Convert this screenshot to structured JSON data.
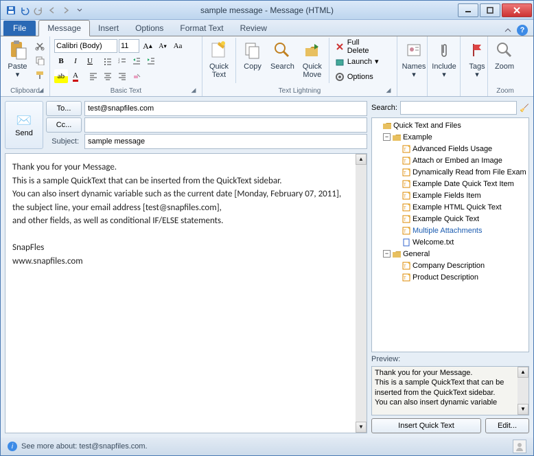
{
  "window": {
    "title": "sample message  -  Message (HTML)"
  },
  "tabs": {
    "file": "File",
    "items": [
      "Message",
      "Insert",
      "Options",
      "Format Text",
      "Review"
    ],
    "active": 0
  },
  "ribbon": {
    "clipboard": {
      "label": "Clipboard",
      "paste": "Paste"
    },
    "basictext": {
      "label": "Basic Text",
      "font": "Calibri (Body)",
      "size": "11"
    },
    "lightning": {
      "label": "Text Lightning",
      "quicktext": "Quick\nText",
      "copy": "Copy",
      "search": "Search",
      "quickmove": "Quick\nMove",
      "fulldelete": "Full Delete",
      "launch": "Launch",
      "options": "Options"
    },
    "names": "Names",
    "include": "Include",
    "tags": "Tags",
    "zoom": {
      "label": "Zoom",
      "btn": "Zoom"
    }
  },
  "header": {
    "send": "Send",
    "to_btn": "To...",
    "cc_btn": "Cc...",
    "subject_lbl": "Subject:",
    "to_val": "test@snapfiles.com",
    "cc_val": "",
    "subject_val": "sample message"
  },
  "body": {
    "l1": "Thank you for your Message.",
    "l2": "This is a sample QuickText that can be inserted from the QuickText sidebar.",
    "l3": "You can also insert dynamic variable such as the current date [Monday, February 07, 2011],",
    "l4": "the subject line, your email address [test@snapfiles.com],",
    "l5": "and other  fields, as well as conditional IF/ELSE statements.",
    "l6": "SnapFles",
    "l7": "www.snapfiles.com"
  },
  "sidebar": {
    "search_lbl": "Search:",
    "root": "Quick Text and Files",
    "example": "Example",
    "ex_items": [
      "Advanced Fields Usage",
      "Attach or Embed an Image",
      "Dynamically Read from File Exam",
      "Example Date Quick Text Item",
      "Example Fields Item",
      "Example HTML Quick Text",
      "Example Quick Text",
      "Multiple Attachments",
      "Welcome.txt"
    ],
    "ex_sel": 7,
    "general": "General",
    "gen_items": [
      "Company Description",
      "Product Description"
    ],
    "preview_lbl": "Preview:",
    "preview_lines": [
      "Thank you for your Message.",
      "This is a sample QuickText that can be",
      "inserted from the QuickText sidebar.",
      "You can also insert dynamic variable"
    ],
    "insert_btn": "Insert Quick Text",
    "edit_btn": "Edit..."
  },
  "status": {
    "text": "See more about: test@snapfiles.com."
  }
}
